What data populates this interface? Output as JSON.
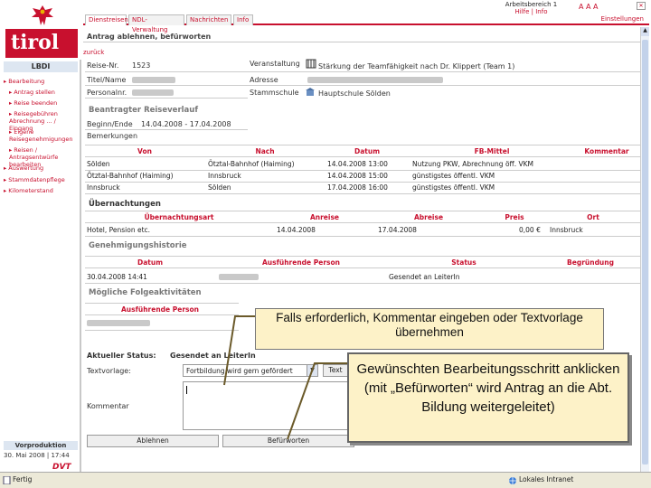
{
  "header": {
    "top_right": [
      "Arbeitsbereich 1",
      "Hilfe | Info"
    ],
    "font_sizes": "A A A",
    "tabs": [
      "Dienstreisen",
      "NDL-Verwaltung",
      "Nachrichten",
      "Info"
    ],
    "settings_label": "Einstellungen"
  },
  "sidebar": {
    "logo_text": "tirol",
    "user_label": "LBDI",
    "items": [
      "Bearbeitung",
      "Antrag stellen",
      "Reise beenden",
      "Reisegebühren Abrechnung ... / Eingang",
      "Eigene Reisegenehmigungen",
      "Reisen / Antragsentwürfe bearbeiten",
      "Auswertung",
      "Stammdatenpflege",
      "Kilometerstand"
    ],
    "footer_label": "Vorproduktion",
    "date": "30. Mai 2008 | 17:44",
    "brand": "DVT"
  },
  "page": {
    "title": "Antrag ablehnen, befürworten",
    "back_link": "zurück"
  },
  "info": {
    "reisenr_label": "Reise-Nr.",
    "reisenr_value": "1523",
    "titel_label": "Titel/Name",
    "personalnr_label": "Personalnr.",
    "veranstaltung_label": "Veranstaltung",
    "veranstaltung_value": "Stärkung der Teamfähigkeit nach Dr. Klippert (Team 1)",
    "adresse_label": "Adresse",
    "stammschule_label": "Stammschule",
    "stammschule_value": "Hauptschule Sölden"
  },
  "reiseverlauf": {
    "title": "Beantragter Reiseverlauf",
    "beginn_label": "Beginn/Ende",
    "beginn_value": "14.04.2008 - 17.04.2008",
    "bemerkungen_label": "Bemerkungen",
    "columns": [
      "Von",
      "Nach",
      "Datum",
      "FB-Mittel",
      "Kommentar"
    ],
    "rows": [
      [
        "Sölden",
        "Ötztal-Bahnhof (Haiming)",
        "14.04.2008 13:00",
        "Nutzung PKW, Abrechnung öff. VKM",
        ""
      ],
      [
        "Ötztal-Bahnhof (Haiming)",
        "Innsbruck",
        "14.04.2008 15:00",
        "günstigstes öffentl. VKM",
        ""
      ],
      [
        "Innsbruck",
        "Sölden",
        "17.04.2008 16:00",
        "günstigstes öffentl. VKM",
        ""
      ]
    ]
  },
  "uebernachtungen": {
    "title": "Übernachtungen",
    "columns": [
      "Übernachtungsart",
      "Anreise",
      "Abreise",
      "Preis",
      "Ort"
    ],
    "rows": [
      [
        "Hotel, Pension etc.",
        "14.04.2008",
        "17.04.2008",
        "0,00 €",
        "Innsbruck"
      ]
    ]
  },
  "genehmigung": {
    "title": "Genehmigungshistorie",
    "columns": [
      "Datum",
      "Ausführende Person",
      "Status",
      "Begründung"
    ],
    "rows": [
      [
        "30.04.2008 14:41",
        "",
        "Gesendet an LeiterIn",
        ""
      ]
    ]
  },
  "folge": {
    "title": "Mögliche Folgeaktivitäten",
    "columns": [
      "Ausführende Person"
    ]
  },
  "form": {
    "status_label": "Aktueller Status:",
    "status_value": "Gesendet an LeiterIn",
    "textvorlage_label": "Textvorlage:",
    "textvorlage_value": "Fortbildung wird gern gefördert",
    "text_button": "Text",
    "kommentar_label": "Kommentar",
    "kommentar_value": "",
    "ablehnen_label": "Ablehnen",
    "befuerworten_label": "Befürworten"
  },
  "callouts": {
    "c1": "Falls erforderlich, Kommentar eingeben oder Textvorlage übernehmen",
    "c2": "Gewünschten Bearbeitungsschritt anklicken (mit „Befürworten“ wird Antrag an die Abt. Bildung weitergeleitet)"
  },
  "statusbar": {
    "left": "Fertig",
    "right": "Lokales Intranet"
  },
  "colors": {
    "accent": "#c8102e",
    "callout_bg": "#fdf2c8",
    "sidebar_bar": "#dde6f1"
  }
}
